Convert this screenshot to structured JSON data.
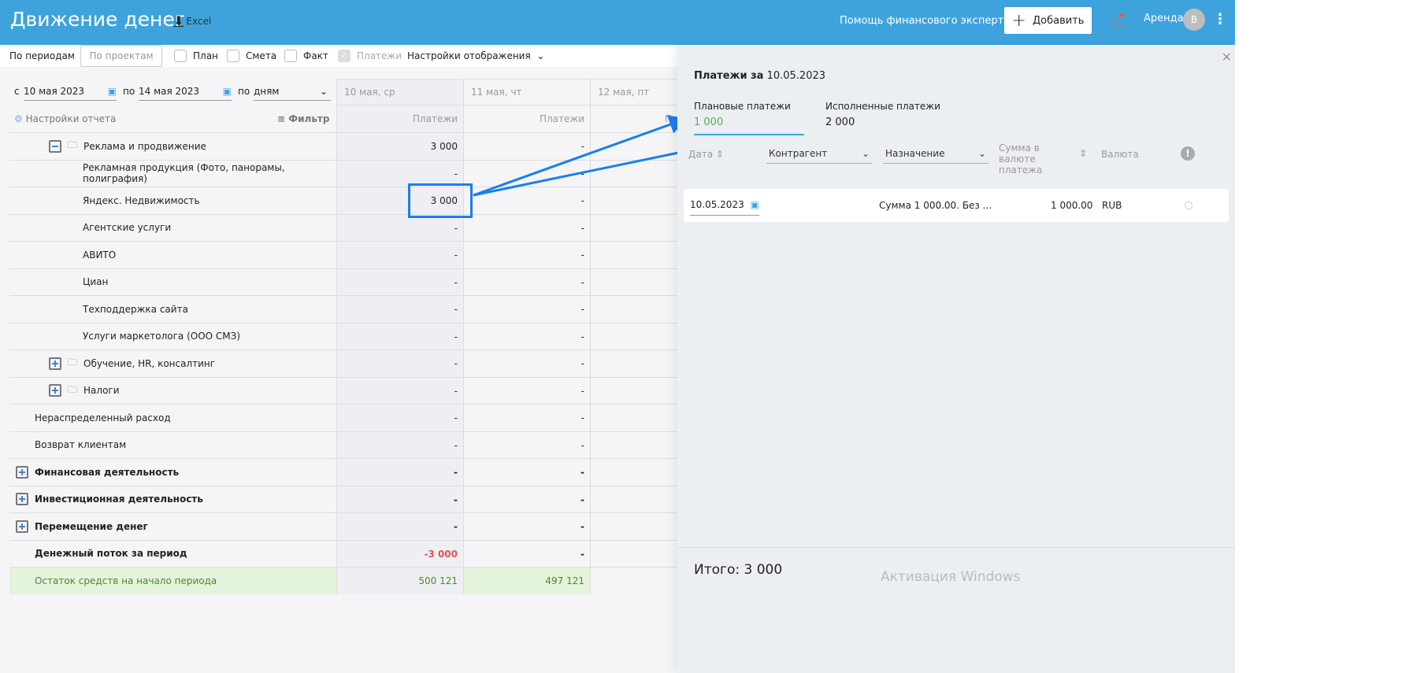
{
  "header": {
    "title": "Движение денег",
    "excel": "Excel",
    "help": "Помощь финансового эксперта",
    "add": "Добавить",
    "org": "Аренда",
    "avatar": "В"
  },
  "toolbar": {
    "by_periods": "По периодам",
    "by_projects": "По проектам",
    "plan": "План",
    "estimate": "Смета",
    "fact": "Факт",
    "payments": "Платежи",
    "display_settings": "Настройки отображения"
  },
  "filters": {
    "from_label": "с",
    "from": "10 мая 2023",
    "to_label": "по",
    "to": "14 мая 2023",
    "by_label": "по",
    "by": "дням",
    "report_settings": "Настройки отчета",
    "filter": "Фильтр"
  },
  "columns": [
    {
      "date": "10 мая, ср",
      "sub": "Платежи"
    },
    {
      "date": "11 мая, чт",
      "sub": "Платежи"
    },
    {
      "date": "12 мая, пт",
      "sub": "П"
    }
  ],
  "rows": [
    {
      "label": "Реклама и продвижение",
      "v1": "3 000",
      "v2": "-"
    },
    {
      "label": "Рекламная продукция (Фото, панорамы, полиграфия)",
      "v1": "-",
      "v2": "-"
    },
    {
      "label": "Яндекс. Недвижимость",
      "v1": "3 000",
      "v2": "-"
    },
    {
      "label": "Агентские услуги",
      "v1": "-",
      "v2": "-"
    },
    {
      "label": "АВИТО",
      "v1": "-",
      "v2": "-"
    },
    {
      "label": "Циан",
      "v1": "-",
      "v2": "-"
    },
    {
      "label": "Техподдержка сайта",
      "v1": "-",
      "v2": "-"
    },
    {
      "label": "Услуги маркетолога (ООО СМЗ)",
      "v1": "-",
      "v2": "-"
    },
    {
      "label": "Обучение, HR, консалтинг",
      "v1": "-",
      "v2": "-"
    },
    {
      "label": "Налоги",
      "v1": "-",
      "v2": "-"
    },
    {
      "label": "Нераспределенный расход",
      "v1": "-",
      "v2": "-"
    },
    {
      "label": "Возврат клиентам",
      "v1": "-",
      "v2": "-"
    },
    {
      "label": "Финансовая деятельность",
      "v1": "-",
      "v2": "-"
    },
    {
      "label": "Инвестиционная деятельность",
      "v1": "-",
      "v2": "-"
    },
    {
      "label": "Перемещение денег",
      "v1": "-",
      "v2": "-"
    },
    {
      "label": "Денежный поток за период",
      "v1": "-3 000",
      "v2": "-"
    },
    {
      "label": "Остаток средств на начало периода",
      "v1": "500 121",
      "v2": "497 121"
    }
  ],
  "panel": {
    "title_prefix": "Платежи за",
    "date": "10.05.2023",
    "planned_label": "Плановые платежи",
    "planned": "1 000",
    "done_label": "Исполненные платежи",
    "done": "2 000",
    "cols": {
      "date": "Дата",
      "counterparty": "Контрагент",
      "purpose": "Назначение",
      "amount": "Сумма в валюте платежа",
      "currency": "Валюта"
    },
    "payment": {
      "date": "10.05.2023",
      "purpose": "Сумма 1 000.00. Без ...",
      "amount": "1 000.00",
      "currency": "RUB"
    },
    "total": "Итого: 3 000",
    "watermark": "Активация Windows"
  },
  "colors": {
    "header": "#3ea3dd",
    "accent": "#1a7ef0",
    "negative": "#e5534b",
    "planned": "#4caf50"
  }
}
